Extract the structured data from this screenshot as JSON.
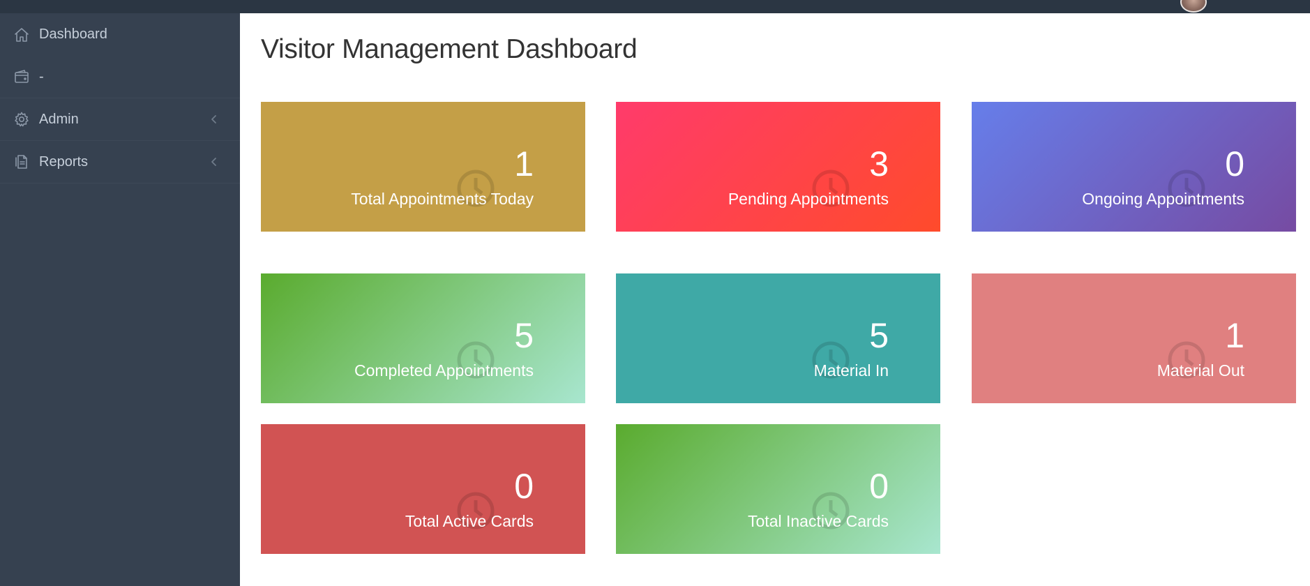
{
  "sidebar": {
    "items": [
      {
        "label": "Dashboard",
        "icon": "home-icon"
      },
      {
        "label": "-",
        "icon": "wallet-icon"
      },
      {
        "label": "Admin",
        "icon": "gear-icon"
      },
      {
        "label": "Reports",
        "icon": "document-icon"
      }
    ]
  },
  "main": {
    "title": "Visitor Management Dashboard",
    "tiles": [
      {
        "value": "1",
        "label": "Total Appointments Today",
        "color": "#c49f47"
      },
      {
        "value": "3",
        "label": "Pending Appointments",
        "color": "#ff4b2b"
      },
      {
        "value": "0",
        "label": "Ongoing Appointments",
        "color": "#764ba2"
      },
      {
        "value": "5",
        "label": "Completed Appointments",
        "color": "#5aab2e"
      },
      {
        "value": "5",
        "label": "Material In",
        "color": "#3fa9a6"
      },
      {
        "value": "1",
        "label": "Material Out",
        "color": "#e08080"
      },
      {
        "value": "0",
        "label": "Total Active Cards",
        "color": "#d15353"
      },
      {
        "value": "0",
        "label": "Total Inactive Cards",
        "color": "#5aab2e"
      }
    ]
  }
}
